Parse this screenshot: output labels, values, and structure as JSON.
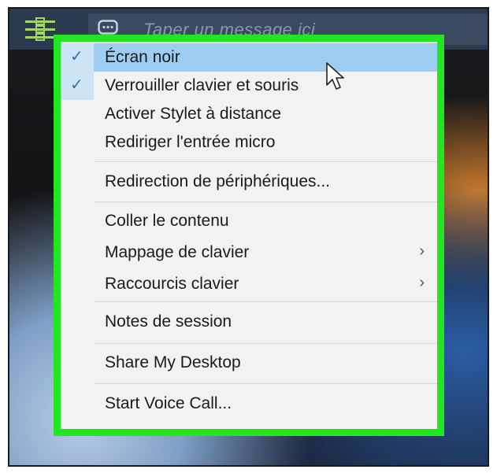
{
  "toolbar": {
    "menu_icon": "hamburger-menu-icon",
    "chat_icon": "chat-bubble-icon",
    "message_placeholder": "Taper un message ici"
  },
  "menu": {
    "items": [
      {
        "label": "Écran noir",
        "checked": true,
        "submenu": false,
        "highlighted": true
      },
      {
        "label": "Verrouiller clavier et souris",
        "checked": true,
        "submenu": false
      },
      {
        "label": "Activer Stylet à distance",
        "checked": false,
        "submenu": false
      },
      {
        "label": "Rediriger l'entrée micro",
        "checked": false,
        "submenu": false
      },
      {
        "label": "Redirection de périphériques...",
        "checked": false,
        "submenu": false
      },
      {
        "label": "Coller le contenu",
        "checked": false,
        "submenu": false
      },
      {
        "label": "Mappage de clavier",
        "checked": false,
        "submenu": true
      },
      {
        "label": "Raccourcis clavier",
        "checked": false,
        "submenu": true
      },
      {
        "label": "Notes de session",
        "checked": false,
        "submenu": false
      },
      {
        "label": "Share My Desktop",
        "checked": false,
        "submenu": false
      },
      {
        "label": "Start Voice Call...",
        "checked": false,
        "submenu": false
      }
    ],
    "check_glyph": "✓",
    "submenu_glyph": "›"
  },
  "colors": {
    "highlight_outline": "#22e622",
    "menu_background": "#f2f2f2",
    "hover_background": "#9ecdf2",
    "toolbar_background": "#2b3a4e"
  }
}
